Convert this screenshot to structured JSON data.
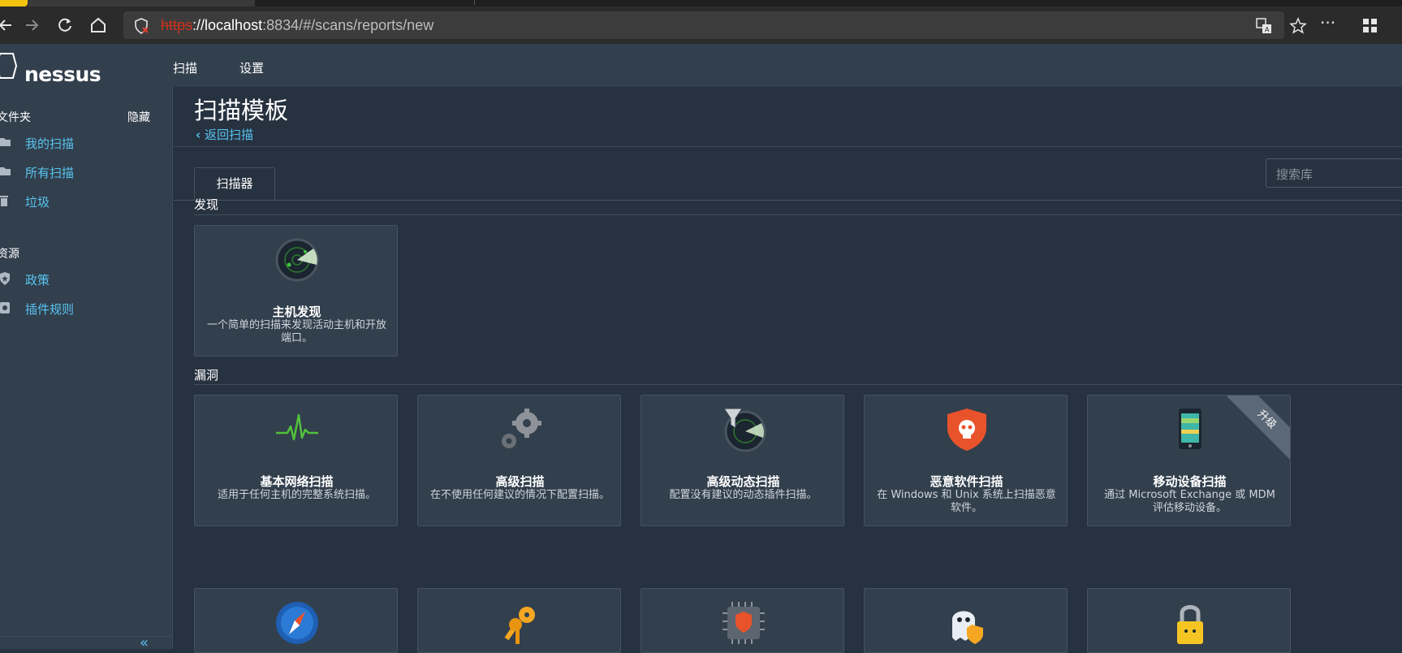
{
  "browser": {
    "url_scheme": "https",
    "url_host": "://localhost",
    "url_rest": ":8834/#/scans/reports/new"
  },
  "app": {
    "logo": "nessus",
    "nav": [
      "扫描",
      "设置"
    ]
  },
  "sidebar": {
    "folders_header": "文件夹",
    "hide_label": "隐藏",
    "folders": [
      {
        "label": "我的扫描",
        "icon": "folder-icon"
      },
      {
        "label": "所有扫描",
        "icon": "folder-icon"
      },
      {
        "label": "垃圾",
        "icon": "trash-icon"
      }
    ],
    "resources_header": "资源",
    "resources": [
      {
        "label": "政策",
        "icon": "policy-icon"
      },
      {
        "label": "插件规则",
        "icon": "plugin-rules-icon"
      }
    ],
    "collapse_symbol": "«"
  },
  "main": {
    "title": "扫描模板",
    "back_link": "返回扫描",
    "tab": "扫描器",
    "search_placeholder": "搜索库",
    "sections": {
      "discovery": "发现",
      "vulnerabilities": "漏洞"
    },
    "discovery_cards": [
      {
        "title": "主机发现",
        "desc": "一个简单的扫描来发现活动主机和开放端口。",
        "icon": "radar-icon"
      }
    ],
    "vuln_cards": [
      {
        "title": "基本网络扫描",
        "desc": "适用于任何主机的完整系统扫描。",
        "icon": "pulse-icon"
      },
      {
        "title": "高级扫描",
        "desc": "在不使用任何建议的情况下配置扫描。",
        "icon": "gears-icon"
      },
      {
        "title": "高级动态扫描",
        "desc": "配置没有建议的动态插件扫描。",
        "icon": "filter-radar-icon"
      },
      {
        "title": "恶意软件扫描",
        "desc": "在 Windows 和 Unix 系统上扫描恶意软件。",
        "icon": "skull-shield-icon"
      },
      {
        "title": "移动设备扫描",
        "desc": "通过 Microsoft Exchange 或 MDM 评估移动设备。",
        "icon": "mobile-icon",
        "ribbon": "升级"
      }
    ],
    "more_cards_icons": [
      "compass-icon",
      "keys-icon",
      "chip-shield-icon",
      "ghost-shield-icon",
      "padlock-icon"
    ]
  }
}
